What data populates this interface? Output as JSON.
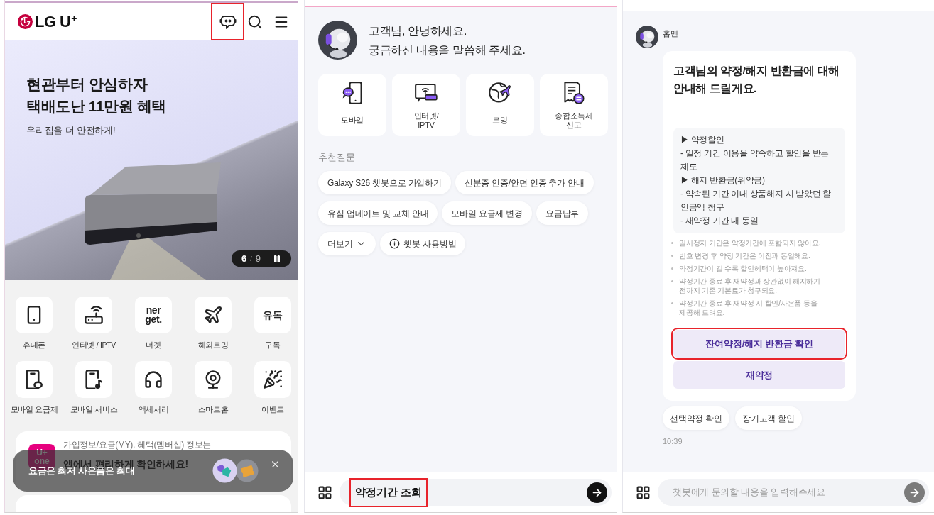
{
  "left_screen": {
    "header": {
      "logo": "LG U$^{+}$",
      "icons": [
        {
          "kind": "chatbot",
          "highlighted": true
        },
        {
          "kind": "search",
          "highlighted": false
        },
        {
          "kind": "menu",
          "highlighted": false
        }
      ]
    },
    "banner": {
      "title_lines": [
        "현관부터 안심하자",
        "택배도난 11만원 혜택"
      ],
      "subtitle": "우리집을 더 안전하게!",
      "pager": {
        "current": "6",
        "separator": "/",
        "total": "9",
        "playing": true
      }
    },
    "shortcuts": [
      {
        "label": "휴대폰",
        "kind": "phone"
      },
      {
        "label": "인터넷 / IPTV",
        "kind": "router"
      },
      {
        "label": "너겟",
        "kind": "wordmark",
        "mark": "ner\nget."
      },
      {
        "label": "해외로밍",
        "kind": "plane"
      },
      {
        "label": "구독",
        "kind": "wordmark",
        "mark": "유독"
      },
      {
        "label": "모바일 요금제",
        "kind": "phone_badge"
      },
      {
        "label": "모바일 서비스",
        "kind": "phone_music"
      },
      {
        "label": "액세서리",
        "kind": "headphones"
      },
      {
        "label": "스마트홈",
        "kind": "webcam"
      },
      {
        "label": "이벤트",
        "kind": "popper"
      }
    ],
    "app_card": {
      "app_logo": "U+\none",
      "lines": [
        "가입정보/요금(MY), 혜택(멤버십) 정보는",
        "앱에서 편리하게 확인하세요!"
      ]
    },
    "toast": {
      "text": "요금은 최저 사은품은 최대"
    }
  },
  "chat_home": {
    "greeting": [
      "고객님, 안녕하세요.",
      "궁금하신 내용을 말씀해 주세요."
    ],
    "categories": [
      {
        "label": "모바일",
        "kind": "mobile"
      },
      {
        "label": "인터넷/\nIPTV",
        "kind": "internet"
      },
      {
        "label": "로밍",
        "kind": "roaming"
      },
      {
        "label": "종합소득세\n신고",
        "kind": "tax"
      }
    ],
    "suggested_title": "추천질문",
    "suggestions": [
      {
        "label": "Galaxy S26 챗봇으로 가입하기",
        "kind": "question"
      },
      {
        "label": "신분증 인증/안면 인증 추가 안내",
        "kind": "question"
      },
      {
        "label": "유심 업데이트 및 교체 안내",
        "kind": "question"
      },
      {
        "label": "모바일 요금제 변경",
        "kind": "question"
      },
      {
        "label": "요금납부",
        "kind": "question"
      },
      {
        "label": "더보기",
        "kind": "more"
      },
      {
        "label": "챗봇 사용방법",
        "kind": "guide"
      }
    ],
    "composer": {
      "value": "약정기간 조회",
      "highlighted": true
    }
  },
  "chat_reply": {
    "bot_name": "홈맨",
    "message": {
      "title": "고객님의 약정/해지 반환금에 대해 안내해 드릴게요.",
      "details": [
        "▶ 약정할인",
        "- 일정 기간 이용을 약속하고 할인을 받는 제도",
        "▶ 해지 반환금(위약금)",
        "- 약속된 기간 이내 상품해지 시 받았던 할인금액 청구",
        "- 재약정 기간 내 동일"
      ],
      "notes": [
        "일시정지 기간은 약정기간에 포함되지 않아요.",
        "번호 변경 후 약정 기간은 이전과 동일해요.",
        "약정기간이 길 수록 할인혜택이 높아져요.",
        "약정기간 종료 후 재약정과 상관없이 해지하기 전까지 기존 기본료가 청구되요.",
        "약정기간 종료 후 재약정 시 할인/사은품 등을 제공해 드려요."
      ],
      "actions": [
        {
          "label": "잔여약정/해지 반환금 확인",
          "highlighted": true
        },
        {
          "label": "재약정",
          "highlighted": false
        }
      ]
    },
    "quick_replies": [
      "선택약정 확인",
      "장기고객 할인"
    ],
    "time": "10:39",
    "composer": {
      "placeholder": "챗봇에게 문의할 내용을 입력해주세요"
    }
  }
}
